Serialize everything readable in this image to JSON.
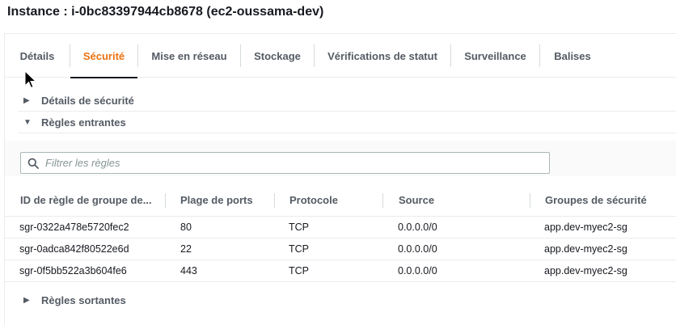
{
  "instance": {
    "title": "Instance : i-0bc83397944cb8678 (ec2-oussama-dev)"
  },
  "tabs": [
    {
      "label": "Détails",
      "active": false
    },
    {
      "label": "Sécurité",
      "active": true
    },
    {
      "label": "Mise en réseau",
      "active": false
    },
    {
      "label": "Stockage",
      "active": false
    },
    {
      "label": "Vérifications de statut",
      "active": false
    },
    {
      "label": "Surveillance",
      "active": false
    },
    {
      "label": "Balises",
      "active": false
    }
  ],
  "sections": {
    "security_details": {
      "label": "Détails de sécurité",
      "expanded": false
    },
    "inbound_rules": {
      "label": "Règles entrantes",
      "expanded": true
    },
    "outbound_rules": {
      "label": "Règles sortantes",
      "expanded": false
    }
  },
  "filter": {
    "placeholder": "Filtrer les règles",
    "value": ""
  },
  "table": {
    "columns": [
      "ID de règle de groupe de...",
      "Plage de ports",
      "Protocole",
      "Source",
      "Groupes de sécurité"
    ],
    "rows": [
      [
        "sgr-0322a478e5720fec2",
        "80",
        "TCP",
        "0.0.0.0/0",
        "app.dev-myec2-sg"
      ],
      [
        "sgr-0adca842f80522e6d",
        "22",
        "TCP",
        "0.0.0.0/0",
        "app.dev-myec2-sg"
      ],
      [
        "sgr-0f5bb522a3b604fe6",
        "443",
        "TCP",
        "0.0.0.0/0",
        "app.dev-myec2-sg"
      ]
    ]
  },
  "colors": {
    "active_tab": "#ec7211",
    "text": "#16191f",
    "secondary_text": "#545b64",
    "border": "#eaeded"
  }
}
